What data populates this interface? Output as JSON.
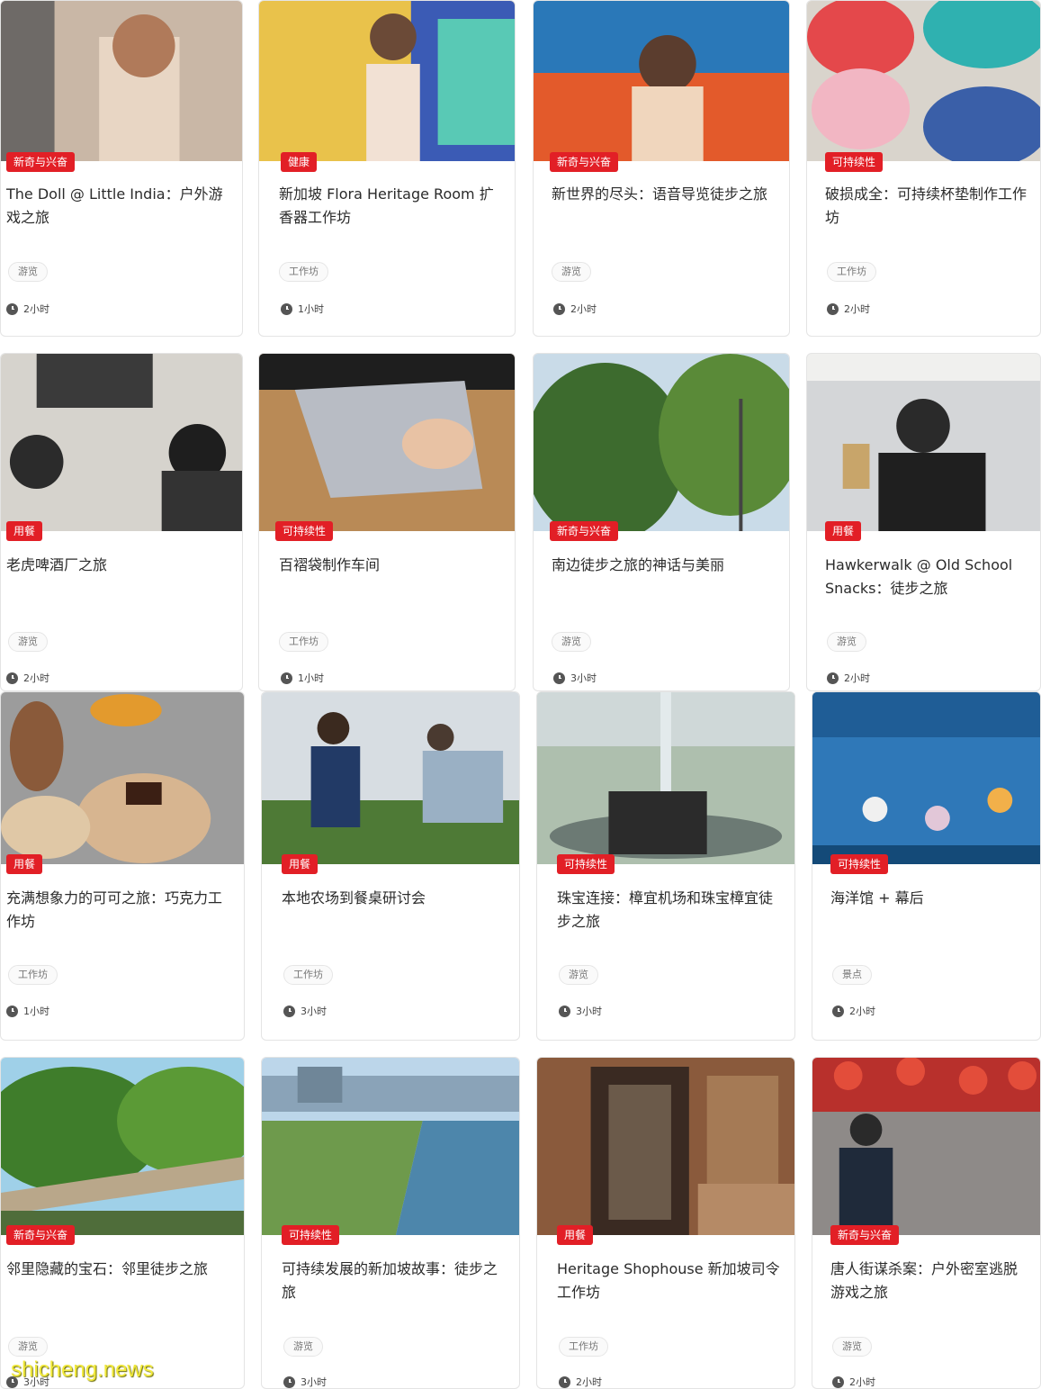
{
  "cards": [
    {
      "badge": "新奇与兴奋",
      "title": "The Doll @ Little India：户外游戏之旅",
      "tag": "游览",
      "duration": "2小时",
      "icon": "clock-icon"
    },
    {
      "badge": "健康",
      "title": "新加坡 Flora Heritage Room 扩香器工作坊",
      "tag": "工作坊",
      "duration": "1小时",
      "icon": "clock-icon"
    },
    {
      "badge": "新奇与兴奋",
      "title": "新世界的尽头：语音导览徒步之旅",
      "tag": "游览",
      "duration": "2小时",
      "icon": "clock-icon"
    },
    {
      "badge": "可持续性",
      "title": "破损成全：可持续杯垫制作工作坊",
      "tag": "工作坊",
      "duration": "2小时",
      "icon": "clock-icon"
    },
    {
      "badge": "用餐",
      "title": "老虎啤酒厂之旅",
      "tag": "游览",
      "duration": "2小时",
      "icon": "clock-icon"
    },
    {
      "badge": "可持续性",
      "title": "百褶袋制作车间",
      "tag": "工作坊",
      "duration": "1小时",
      "icon": "clock-icon"
    },
    {
      "badge": "新奇与兴奋",
      "title": "南边徒步之旅的神话与美丽",
      "tag": "游览",
      "duration": "3小时",
      "icon": "clock-icon"
    },
    {
      "badge": "用餐",
      "title": "Hawkerwalk @ Old School Snacks：徒步之旅",
      "tag": "游览",
      "duration": "2小时",
      "icon": "clock-icon"
    },
    {
      "badge": "用餐",
      "title": "充满想象力的可可之旅：巧克力工作坊",
      "tag": "工作坊",
      "duration": "1小时",
      "icon": "clock-icon"
    },
    {
      "badge": "用餐",
      "title": "本地农场到餐桌研讨会",
      "tag": "工作坊",
      "duration": "3小时",
      "icon": "clock-icon"
    },
    {
      "badge": "可持续性",
      "title": "珠宝连接：樟宜机场和珠宝樟宜徒步之旅",
      "tag": "游览",
      "duration": "3小时",
      "icon": "clock-icon"
    },
    {
      "badge": "可持续性",
      "title": "海洋馆 + 幕后",
      "tag": "景点",
      "duration": "2小时",
      "icon": "clock-icon"
    },
    {
      "badge": "新奇与兴奋",
      "title": "邻里隐藏的宝石：邻里徒步之旅",
      "tag": "游览",
      "duration": "3小时",
      "icon": "clock-icon"
    },
    {
      "badge": "可持续性",
      "title": "可持续发展的新加坡故事：徒步之旅",
      "tag": "游览",
      "duration": "3小时",
      "icon": "clock-icon"
    },
    {
      "badge": "用餐",
      "title": "Heritage Shophouse 新加坡司令工作坊",
      "tag": "工作坊",
      "duration": "2小时",
      "icon": "clock-icon"
    },
    {
      "badge": "新奇与兴奋",
      "title": "唐人街谋杀案：户外密室逃脱游戏之旅",
      "tag": "游览",
      "duration": "2小时",
      "icon": "clock-icon"
    }
  ],
  "watermark": "shicheng.news",
  "colors": {
    "badge": "#e21f26",
    "accent": "#e21f26"
  }
}
